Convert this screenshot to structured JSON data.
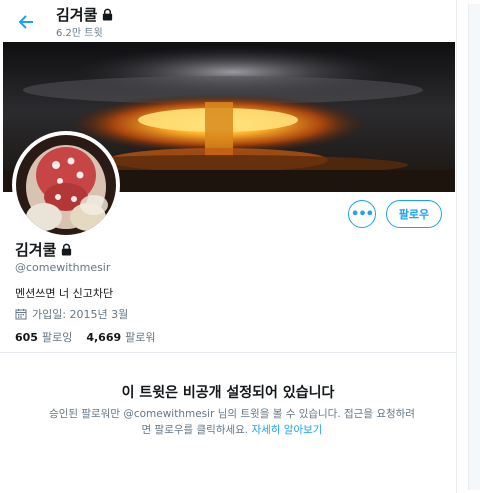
{
  "header": {
    "title": "김겨쿨",
    "tweet_count": "6.2만 트윗"
  },
  "profile": {
    "name": "김겨쿨",
    "handle": "@comewithmesir",
    "bio": "멘션쓰면 너 신고차단",
    "joined": "가입일: 2015년 3월",
    "following_count": "605",
    "following_label": "팔로잉",
    "followers_count": "4,669",
    "followers_label": "팔로워"
  },
  "actions": {
    "more_label": "•••",
    "follow_label": "팔로우"
  },
  "private_notice": {
    "title": "이 트윗은 비공개 설정되어 있습니다",
    "desc_line1": "승인된 팔로워만 @comewithmesir 님의 트윗을 볼 수 있습니다. 접근을 요청하려",
    "desc_line2_prefix": "면 팔로우를 클릭하세요. ",
    "learn_more": "자세히 알아보기"
  },
  "colors": {
    "accent": "#1da1f2",
    "secondary_text": "#657786",
    "border": "#e6ecf0"
  },
  "icons": [
    "back-arrow-icon",
    "lock-icon",
    "calendar-icon",
    "more-dots-icon"
  ]
}
